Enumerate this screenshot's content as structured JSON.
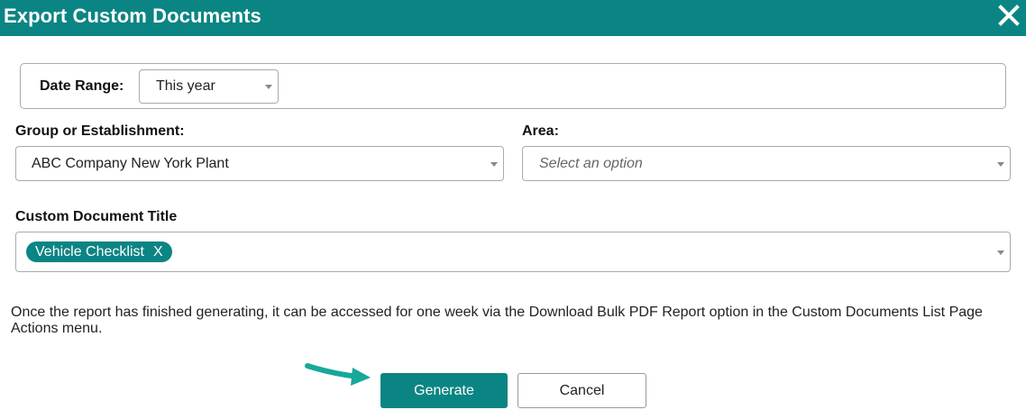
{
  "dialog": {
    "title": "Export Custom Documents",
    "close_icon": "close-icon"
  },
  "date_range": {
    "label": "Date Range:",
    "value": "This year"
  },
  "group": {
    "label": "Group or Establishment:",
    "value": "ABC Company New York Plant"
  },
  "area": {
    "label": "Area:",
    "placeholder": "Select an option"
  },
  "custom_document_title": {
    "label": "Custom Document Title",
    "chips": [
      {
        "label": "Vehicle Checklist",
        "remove": "X"
      }
    ]
  },
  "info_text": "Once the report has finished generating, it can be accessed for one week via the Download Bulk PDF Report option in the Custom Documents List Page Actions menu.",
  "buttons": {
    "generate": "Generate",
    "cancel": "Cancel"
  },
  "colors": {
    "accent": "#0b8583",
    "arrow": "#17a899"
  }
}
